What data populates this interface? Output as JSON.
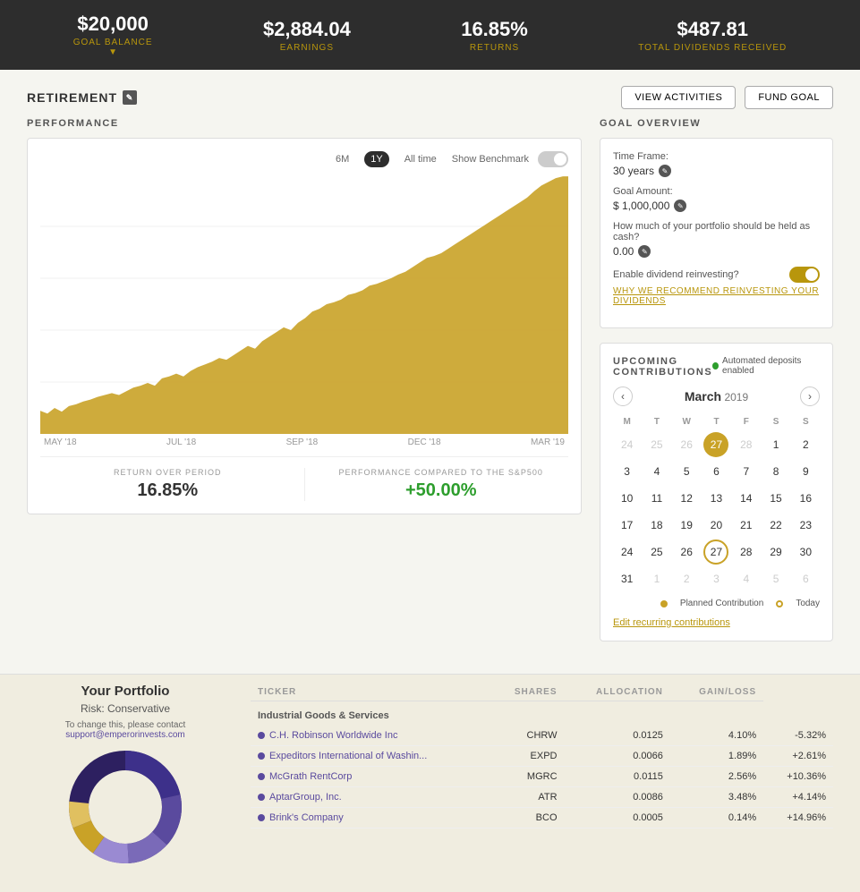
{
  "topBar": {
    "goalBalance": {
      "label": "GOAL BALANCE",
      "value": "$20,000",
      "arrow": "▼"
    },
    "earnings": {
      "label": "EARNINGS",
      "value": "$2,884.04"
    },
    "returns": {
      "label": "RETURNS",
      "value": "16.85%"
    },
    "dividends": {
      "label": "TOTAL DIVIDENDS RECEIVED",
      "value": "$487.81"
    }
  },
  "header": {
    "title": "RETIREMENT",
    "viewActivities": "VIEW ACTIVITIES",
    "fundGoal": "FUND GOAL"
  },
  "performance": {
    "sectionTitle": "PERFORMANCE",
    "buttons": [
      "6M",
      "1Y",
      "All time"
    ],
    "activeButton": "1Y",
    "benchmarkLabel": "Show Benchmark",
    "chartLabels": [
      "MAY '18",
      "JUL '18",
      "SEP '18",
      "DEC '18",
      "MAR '19"
    ],
    "returnLabel": "RETURN OVER PERIOD",
    "returnValue": "16.85%",
    "comparisonLabel": "PERFORMANCE COMPARED TO THE S&P500",
    "comparisonValue": "+50.00%"
  },
  "goalOverview": {
    "sectionTitle": "GOAL OVERVIEW",
    "timeFrameLabel": "Time Frame:",
    "timeFrameValue": "30 years",
    "goalAmountLabel": "Goal Amount:",
    "goalAmountValue": "$ 1,000,000",
    "cashQuestion": "How much of your portfolio should be held as cash?",
    "cashValue": "0.00",
    "dividendLabel": "Enable dividend reinvesting?",
    "dividendLink": "WHY WE RECOMMEND REINVESTING YOUR DIVIDENDS"
  },
  "contributions": {
    "sectionTitle": "UPCOMING\nCONTRIBUTIONS",
    "autoDeposit": "Automated deposits enabled",
    "calendar": {
      "month": "March",
      "year": "2019",
      "dayHeaders": [
        "M",
        "T",
        "W",
        "T",
        "F",
        "S",
        "S"
      ],
      "weeks": [
        [
          {
            "day": 24,
            "other": true
          },
          {
            "day": 25,
            "other": true
          },
          {
            "day": 26,
            "other": true
          },
          {
            "day": 27,
            "planned": true
          },
          {
            "day": 28,
            "other": true
          },
          {
            "day": 1
          },
          {
            "day": 2
          }
        ],
        [
          {
            "day": 3
          },
          {
            "day": 4
          },
          {
            "day": 5
          },
          {
            "day": 6
          },
          {
            "day": 7
          },
          {
            "day": 8
          },
          {
            "day": 9
          }
        ],
        [
          {
            "day": 10
          },
          {
            "day": 11
          },
          {
            "day": 12
          },
          {
            "day": 13
          },
          {
            "day": 14
          },
          {
            "day": 15
          },
          {
            "day": 16
          }
        ],
        [
          {
            "day": 17
          },
          {
            "day": 18
          },
          {
            "day": 19
          },
          {
            "day": 20
          },
          {
            "day": 21
          },
          {
            "day": 22
          },
          {
            "day": 23
          }
        ],
        [
          {
            "day": 24
          },
          {
            "day": 25
          },
          {
            "day": 26
          },
          {
            "day": 27,
            "today": true
          },
          {
            "day": 28
          },
          {
            "day": 29
          },
          {
            "day": 30
          }
        ],
        [
          {
            "day": 31
          },
          {
            "day": 1,
            "other": true
          },
          {
            "day": 2,
            "other": true
          },
          {
            "day": 3,
            "other": true
          },
          {
            "day": 4,
            "other": true
          },
          {
            "day": 5,
            "other": true
          },
          {
            "day": 6,
            "other": true
          }
        ]
      ],
      "legendPlanned": "Planned Contribution",
      "legendToday": "Today"
    },
    "editLink": "Edit recurring contributions"
  },
  "portfolio": {
    "title": "Your Portfolio",
    "risk": "Risk: Conservative",
    "contactText": "To change this, please contact",
    "contactEmail": "support@emperorinvests.com",
    "sectorLabel": "Industrial Goods & Services",
    "columns": [
      "Ticker",
      "Shares",
      "Allocation",
      "Gain/Loss"
    ],
    "stocks": [
      {
        "name": "C.H. Robinson Worldwide Inc",
        "ticker": "CHRW",
        "shares": "0.0125",
        "allocation": "4.10%",
        "gainLoss": "-5.32%",
        "positive": false,
        "color": "#5a4a9e"
      },
      {
        "name": "Expeditors International of Washin...",
        "ticker": "EXPD",
        "shares": "0.0066",
        "allocation": "1.89%",
        "gainLoss": "+2.61%",
        "positive": true,
        "color": "#5a4a9e"
      },
      {
        "name": "McGrath RentCorp",
        "ticker": "MGRC",
        "shares": "0.0115",
        "allocation": "2.56%",
        "gainLoss": "+10.36%",
        "positive": true,
        "color": "#5a4a9e"
      },
      {
        "name": "AptarGroup, Inc.",
        "ticker": "ATR",
        "shares": "0.0086",
        "allocation": "3.48%",
        "gainLoss": "+4.14%",
        "positive": true,
        "color": "#5a4a9e"
      },
      {
        "name": "Brink's Company",
        "ticker": "BCO",
        "shares": "0.0005",
        "allocation": "0.14%",
        "gainLoss": "+14.96%",
        "positive": true,
        "color": "#5a4a9e"
      }
    ],
    "donutColors": [
      "#2d2060",
      "#3d308a",
      "#5a4a9e",
      "#7a6ab8",
      "#9a8ad2",
      "#baaae8",
      "#c9a227",
      "#e0c060",
      "#f0e0a0"
    ]
  }
}
